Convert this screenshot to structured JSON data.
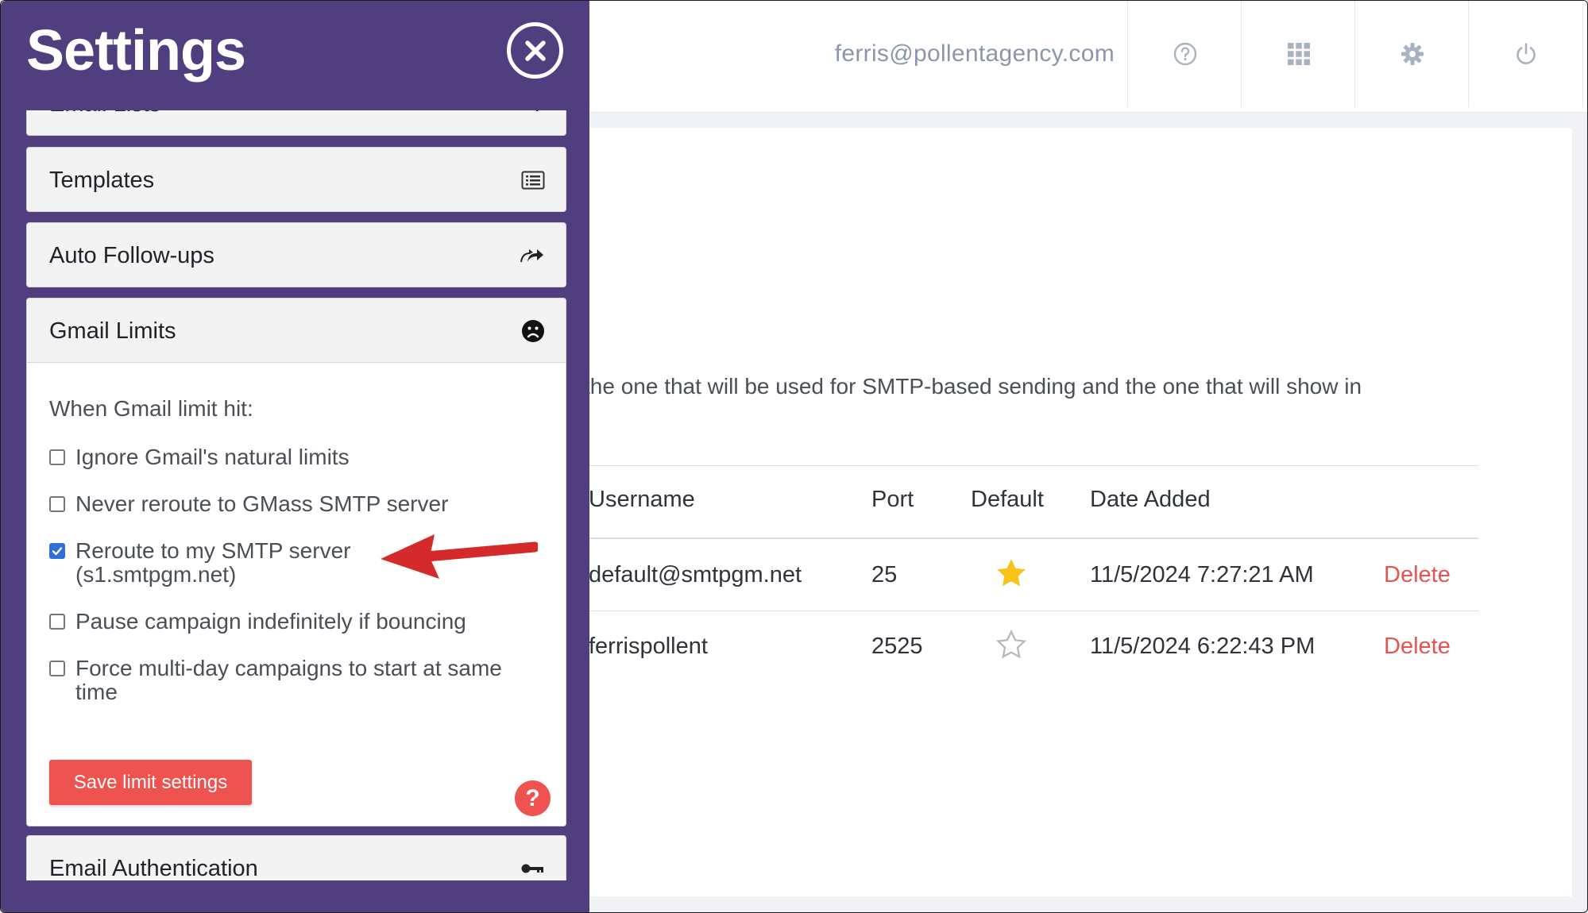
{
  "panel": {
    "title": "Settings",
    "items": [
      {
        "label": "Email Lists",
        "icon": "list-edit-icon"
      },
      {
        "label": "Templates",
        "icon": "list-icon"
      },
      {
        "label": "Auto Follow-ups",
        "icon": "forward-icon"
      },
      {
        "label": "Gmail Limits",
        "icon": "sad-face-icon"
      },
      {
        "label": "Email Authentication",
        "icon": "key-icon"
      }
    ],
    "gmail_limits": {
      "heading": "When Gmail limit hit:",
      "options": [
        {
          "label": "Ignore Gmail's natural limits",
          "checked": false
        },
        {
          "label": "Never reroute to GMass SMTP server",
          "checked": false
        },
        {
          "label": "Reroute to my SMTP server (s1.smtpgm.net)",
          "checked": true
        },
        {
          "label": "Pause campaign indefinitely if bouncing",
          "checked": false
        },
        {
          "label": "Force multi-day campaigns to start at same time",
          "checked": false
        }
      ],
      "save_label": "Save limit settings",
      "help_label": "?"
    }
  },
  "topbar": {
    "email": "ferris@pollentagency.com",
    "icons": [
      "help-icon",
      "apps-grid-icon",
      "gear-icon",
      "power-icon"
    ]
  },
  "main": {
    "description": "the one that will be used for SMTP-based sending and the one that will show in",
    "table": {
      "headers": [
        "Username",
        "Port",
        "Default",
        "Date Added"
      ],
      "rows": [
        {
          "username": "default@smtpgm.net",
          "port": "25",
          "default": true,
          "date": "11/5/2024 7:27:21 AM",
          "action": "Delete"
        },
        {
          "username": "ferrispollent",
          "port": "2525",
          "default": false,
          "date": "11/5/2024 6:22:43 PM",
          "action": "Delete"
        }
      ]
    }
  },
  "colors": {
    "panel": "#4f3f7e",
    "accent": "#ef5350",
    "star": "#f9c31a",
    "arrow": "#d42a2a"
  }
}
